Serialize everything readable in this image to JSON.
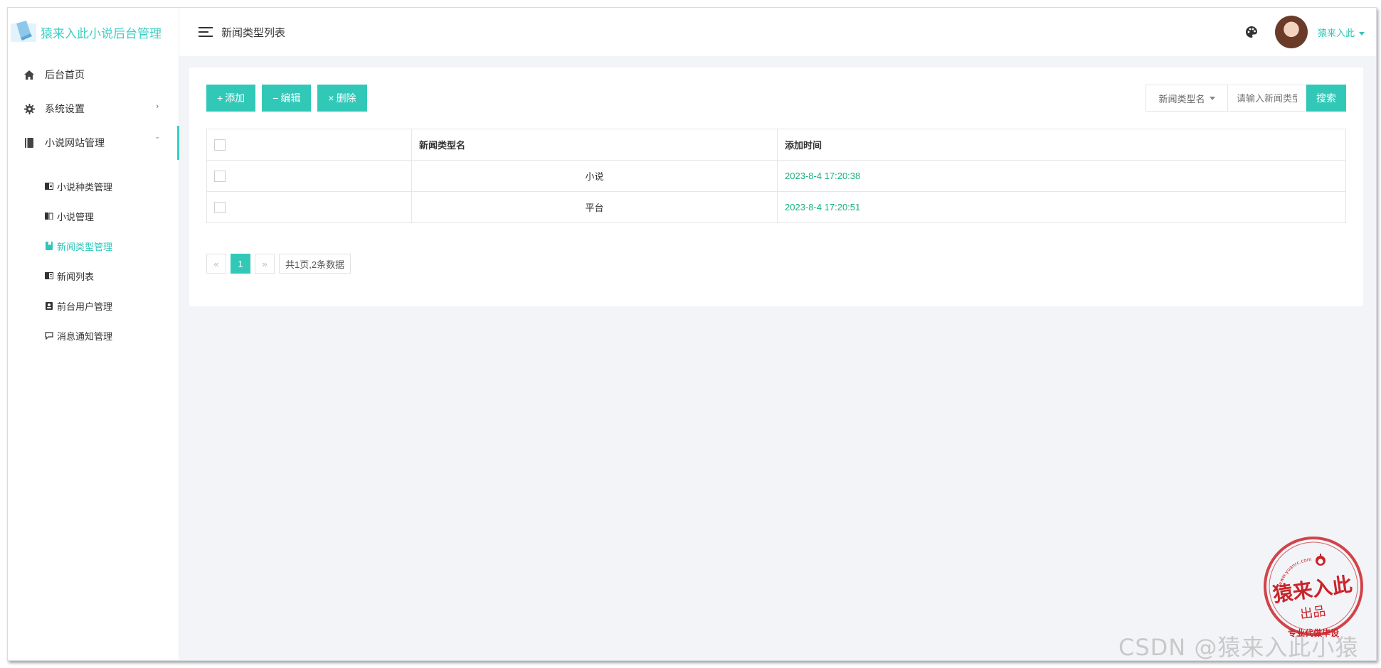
{
  "brand": {
    "title": "猿来入此小说后台管理"
  },
  "header": {
    "page_title": "新闻类型列表",
    "user_name": "猿来入此"
  },
  "sidebar": {
    "items": [
      {
        "label": "后台首页",
        "icon": "home-icon"
      },
      {
        "label": "系统设置",
        "icon": "gear-icon",
        "chevron": "›"
      },
      {
        "label": "小说网站管理",
        "icon": "book-icon",
        "chevron": "ˇ"
      }
    ],
    "subitems": [
      {
        "label": "小说种类管理",
        "icon": "book-open-icon"
      },
      {
        "label": "小说管理",
        "icon": "books-icon"
      },
      {
        "label": "新闻类型管理",
        "icon": "bookmark-icon",
        "active": true
      },
      {
        "label": "新闻列表",
        "icon": "book-open-icon"
      },
      {
        "label": "前台用户管理",
        "icon": "user-card-icon"
      },
      {
        "label": "消息通知管理",
        "icon": "message-icon"
      }
    ]
  },
  "toolbar": {
    "add_label": "添加",
    "edit_label": "编辑",
    "delete_label": "删除"
  },
  "search": {
    "field": "新闻类型名",
    "placeholder": "请输入新闻类型名",
    "button": "搜索"
  },
  "table": {
    "headers": [
      "",
      "新闻类型名",
      "添加时间"
    ],
    "rows": [
      {
        "name": "小说",
        "time": "2023-8-4 17:20:38"
      },
      {
        "name": "平台",
        "time": "2023-8-4 17:20:51"
      }
    ]
  },
  "pagination": {
    "prev": "«",
    "current": "1",
    "next": "»",
    "info": "共1页,2条数据"
  },
  "watermark": {
    "text": "CSDN @猿来入此小猿"
  },
  "stamp": {
    "main": "猿来入此",
    "sub": "出品",
    "url": "www.yuanrc.com",
    "bottom": "专业代做毕设",
    "icon": "apple-icon"
  },
  "colors": {
    "accent": "#32c8b8",
    "time_text": "#16b27a",
    "stamp": "#c9242a"
  }
}
